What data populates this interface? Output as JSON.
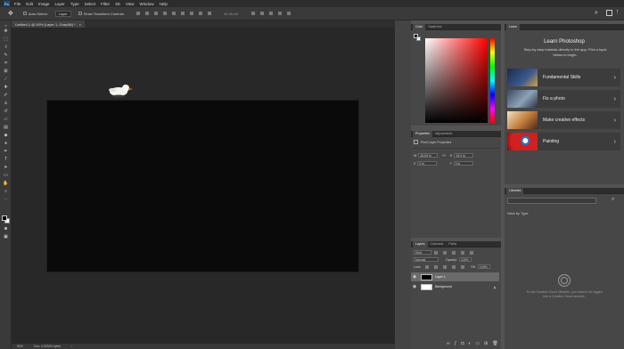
{
  "menubar": {
    "logo": "Ps",
    "items": [
      "File",
      "Edit",
      "Image",
      "Layer",
      "Type",
      "Select",
      "Filter",
      "3D",
      "View",
      "Window",
      "Help"
    ]
  },
  "options_bar": {
    "auto_select_label": "Auto-Select:",
    "layer_dropdown": "Layer",
    "show_transform_label": "Show Transform Controls",
    "mode_3d_label": "3D Mode:"
  },
  "document_tab": {
    "title": "Untitled-1 @ 50% (Layer 1, Gray/8#) *"
  },
  "status_bar": {
    "zoom": "50%",
    "doc_size": "Doc: 4.92M/0 bytes"
  },
  "color_panel": {
    "tabs": [
      "Color",
      "Swatches"
    ]
  },
  "properties_panel": {
    "tabs": [
      "Properties",
      "Adjustments"
    ],
    "layer_type": "Pixel Layer Properties",
    "w_label": "W",
    "w_value": "26.69 in",
    "go_label": "GO",
    "h_label": "H",
    "h_value": "15.0 in",
    "x_label": "X",
    "x_value": "0 in",
    "y_label": "Y",
    "y_value": "0 in"
  },
  "layers_panel": {
    "tabs": [
      "Layers",
      "Channels",
      "Paths"
    ],
    "kind_label": "Kind",
    "blend_mode": "Normal",
    "opacity_label": "Opacity:",
    "opacity_value": "100%",
    "lock_label": "Lock:",
    "fill_label": "Fill:",
    "fill_value": "100%",
    "layers": [
      {
        "name": "Layer 1",
        "selected": true
      },
      {
        "name": "Background",
        "selected": false
      }
    ]
  },
  "learn_panel": {
    "tab": "Learn",
    "title": "Learn Photoshop",
    "subtitle": "Step-by-step tutorials directly in the app. Pick a topic below to begin.",
    "items": [
      {
        "label": "Fundamental Skills",
        "thumb_color": "#2b3f66"
      },
      {
        "label": "Fix a photo",
        "thumb_color": "#5a6e88"
      },
      {
        "label": "Make creative effects",
        "thumb_color": "#b8743a"
      },
      {
        "label": "Painting",
        "thumb_color": "#c0392b"
      }
    ]
  },
  "libraries_panel": {
    "tab": "Libraries",
    "view_by": "View by Type",
    "message": "To use Creative Cloud Libraries, you need to be logged into a Creative Cloud account."
  },
  "colors": {
    "accent": "#31a8ff",
    "canvas_bg": "#282828",
    "doc_bg": "#0a0a0a"
  }
}
